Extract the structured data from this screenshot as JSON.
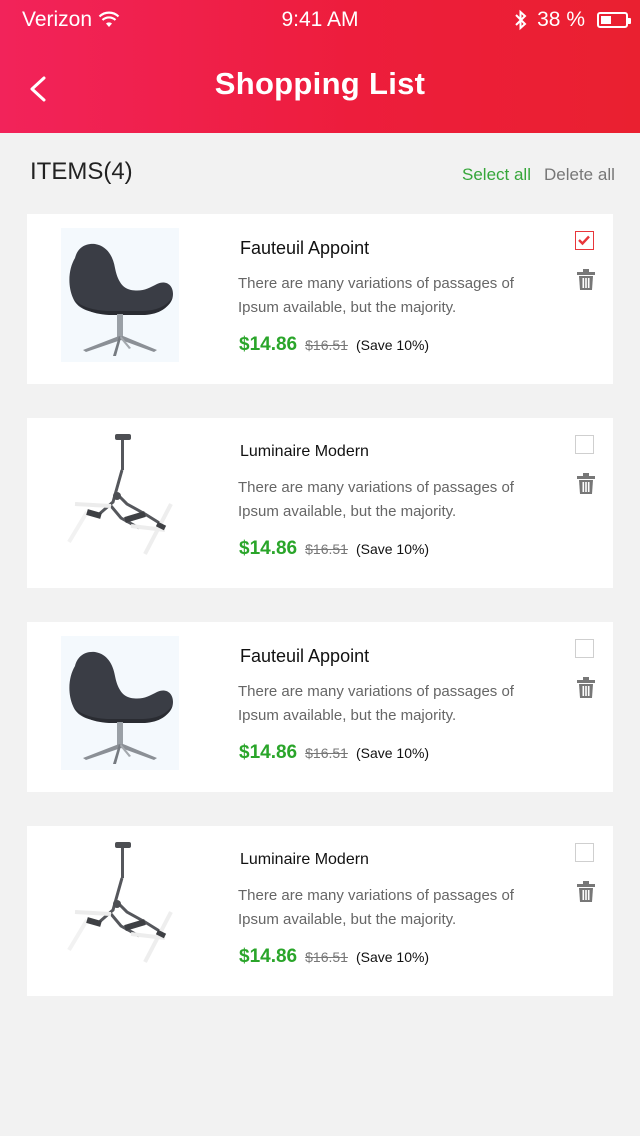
{
  "status_bar": {
    "carrier": "Verizon",
    "time": "9:41 AM",
    "battery": "38 %",
    "icons": [
      "wifi-icon",
      "bluetooth-icon",
      "battery-icon"
    ]
  },
  "header": {
    "title": "Shopping List",
    "back_icon": "chevron-left-icon"
  },
  "toolbar": {
    "items_count": "ITEMS(4)",
    "select_all": "Select all",
    "delete_all": "Delete all"
  },
  "colors": {
    "header_gradient_start": "#f2235a",
    "header_gradient_end": "#ea2030",
    "price_green": "#2aa52a",
    "select_all_green": "#36a63a",
    "checkbox_red": "#e8363b"
  },
  "items": [
    {
      "name": "Fauteuil Appoint",
      "description": "There are many variations of passages of Ipsum available, but the majority.",
      "price": "$14.86",
      "old_price": "$16.51",
      "save": "(Save 10%)",
      "checked": true,
      "image": "swan-chair"
    },
    {
      "name": "Luminaire Modern",
      "description": "There are many variations of passages of Ipsum available, but the majority.",
      "price": "$14.86",
      "old_price": "$16.51",
      "save": "(Save 10%)",
      "checked": false,
      "image": "pendant-lamp"
    },
    {
      "name": "Fauteuil Appoint",
      "description": "There are many variations of passages of Ipsum available, but the majority.",
      "price": "$14.86",
      "old_price": "$16.51",
      "save": "(Save 10%)",
      "checked": false,
      "image": "swan-chair"
    },
    {
      "name": "Luminaire Modern",
      "description": "There are many variations of passages of Ipsum available, but the majority.",
      "price": "$14.86",
      "old_price": "$16.51",
      "save": "(Save 10%)",
      "checked": false,
      "image": "pendant-lamp"
    }
  ]
}
